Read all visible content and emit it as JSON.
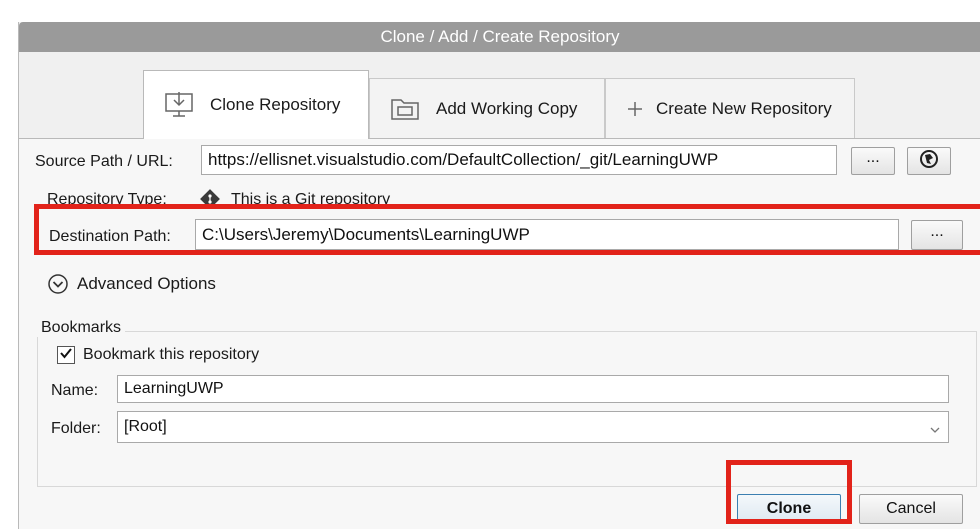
{
  "window": {
    "title": "Clone / Add / Create Repository"
  },
  "tabs": [
    {
      "label": "Clone Repository",
      "icon": "download-computer-icon",
      "active": true
    },
    {
      "label": "Add Working Copy",
      "icon": "folder-icon",
      "active": false
    },
    {
      "label": "Create New Repository",
      "icon": "plus-icon",
      "active": false
    }
  ],
  "source": {
    "label": "Source Path / URL:",
    "value": "https://ellisnet.visualstudio.com/DefaultCollection/_git/LearningUWP",
    "browse_label": "...",
    "remote_icon": "globe-icon"
  },
  "repo_type": {
    "label": "Repository Type:",
    "value": "This is a Git repository",
    "icon": "git-icon"
  },
  "destination": {
    "label": "Destination Path:",
    "value": "C:\\Users\\Jeremy\\Documents\\LearningUWP",
    "browse_label": "..."
  },
  "advanced": {
    "label": "Advanced Options"
  },
  "bookmarks": {
    "title": "Bookmarks",
    "checkbox_label": "Bookmark this repository",
    "checked": true,
    "name_label": "Name:",
    "name_value": "LearningUWP",
    "folder_label": "Folder:",
    "folder_value": "[Root]"
  },
  "actions": {
    "clone_label": "Clone",
    "cancel_label": "Cancel"
  },
  "colors": {
    "highlight": "#e2231a",
    "titlebar": "#9a9a9a"
  }
}
